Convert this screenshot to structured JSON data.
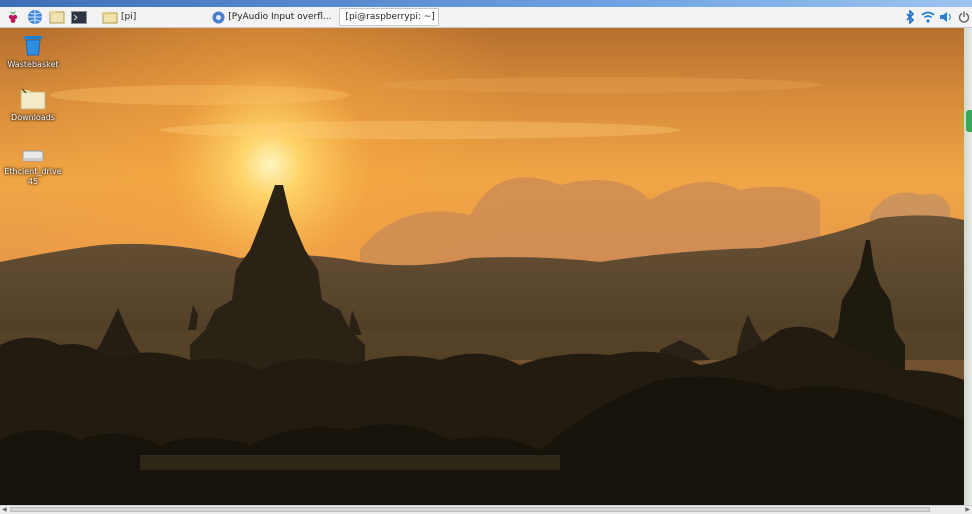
{
  "taskbar": {
    "buttons": [
      {
        "icon": "raspberry-menu-icon"
      },
      {
        "icon": "web-browser-icon"
      },
      {
        "icon": "file-manager-icon"
      },
      {
        "icon": "terminal-icon"
      }
    ],
    "windows": [
      {
        "icon": "folder-icon",
        "label": "[pi]",
        "active": false
      },
      {
        "icon": "chromium-icon",
        "label": "[PyAudio Input overfl...",
        "active": false
      },
      {
        "icon": "terminal-icon",
        "label": "[pi@raspberrypi: ~]",
        "active": true
      }
    ],
    "tray": [
      {
        "icon": "bluetooth-icon"
      },
      {
        "icon": "wifi-icon"
      },
      {
        "icon": "volume-icon"
      },
      {
        "icon": "power-icon"
      }
    ]
  },
  "desktop": {
    "icons": [
      {
        "name": "wastebasket-icon",
        "label": "Wastebasket"
      },
      {
        "name": "downloads-folder-icon",
        "label": "Downloads"
      },
      {
        "name": "drive-icon",
        "label": "Ethcient_drive 45"
      }
    ]
  },
  "colors": {
    "taskbar_bg": "#f3f3f3",
    "sky_top": "#d98a2a",
    "sun": "#fff1a8",
    "silhouette": "#1e1a10"
  }
}
